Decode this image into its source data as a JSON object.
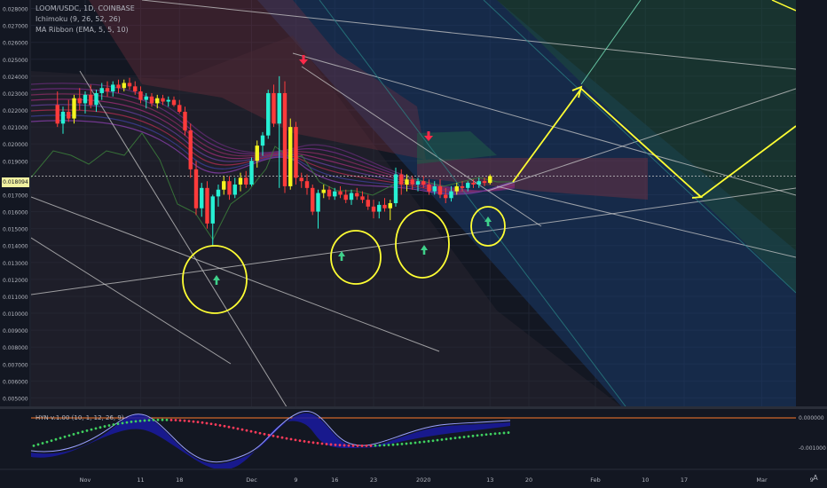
{
  "title_line": "LOOM/USDC, 1D, COINBASE",
  "indicators": [
    "Ichimoku (9, 26, 52, 26)",
    "MA Ribbon (EMA, 5, 5, 10)"
  ],
  "oscillator_label": "HYN v.1.00 (10, 1, 12, 26, 9)",
  "current_price_label": "0.018094",
  "colors": {
    "background": "#131722",
    "bull": "#26f0d4",
    "bear": "#ff3b3b",
    "bull_yellow": "#f5f51f",
    "annotation": "#ffff33",
    "trendline": "#c9c9c9",
    "cloud_bear": "#7a3040",
    "cloud_bull": "#205848",
    "channel_blue": "#1a3a6a",
    "channel_green": "#1e4a3a",
    "arrow_down": "#ff2a4a",
    "arrow_up": "#3fd08a"
  },
  "chart_data": {
    "type": "line",
    "title": "LOOM/USDC, 1D, COINBASE",
    "y_axis": {
      "min": 0.0045,
      "max": 0.0285,
      "tick_labels": [
        "0.028000",
        "0.027000",
        "0.026000",
        "0.025000",
        "0.024000",
        "0.023000",
        "0.022000",
        "0.021000",
        "0.020000",
        "0.019000",
        "0.017000",
        "0.016000",
        "0.015000",
        "0.014000",
        "0.013000",
        "0.012000",
        "0.011000",
        "0.010000",
        "0.009000",
        "0.008000",
        "0.007000",
        "0.006000",
        "0.005000"
      ],
      "tick_values": [
        0.028,
        0.027,
        0.026,
        0.025,
        0.024,
        0.023,
        0.022,
        0.021,
        0.02,
        0.019,
        0.017,
        0.016,
        0.015,
        0.014,
        0.013,
        0.012,
        0.011,
        0.01,
        0.009,
        0.008,
        0.007,
        0.006,
        0.005
      ]
    },
    "x_axis": {
      "tick_labels": [
        "Nov",
        "11",
        "18",
        "Dec",
        "9",
        "16",
        "23",
        "2020",
        "13",
        "20",
        "Feb",
        "10",
        "17",
        "Mar",
        "9"
      ],
      "tick_days": [
        0,
        10,
        17,
        30,
        38,
        45,
        52,
        61,
        73,
        80,
        92,
        101,
        108,
        122,
        131
      ]
    },
    "oscillator_axis": {
      "tick_labels": [
        "0.000000",
        "-0.001000"
      ],
      "tick_values": [
        0.0,
        -0.001
      ]
    },
    "series": [
      {
        "kind": "candles",
        "start_day": -5,
        "candles": [
          [
            0.0223,
            0.0231,
            0.021,
            0.0212
          ],
          [
            0.0212,
            0.0222,
            0.0206,
            0.0219
          ],
          [
            0.0219,
            0.0226,
            0.0213,
            0.0215
          ],
          [
            0.0215,
            0.0229,
            0.0212,
            0.0227
          ],
          [
            0.0227,
            0.0233,
            0.022,
            0.0224
          ],
          [
            0.0224,
            0.0231,
            0.0218,
            0.0229
          ],
          [
            0.0229,
            0.0235,
            0.0221,
            0.0223
          ],
          [
            0.0223,
            0.0232,
            0.0219,
            0.023
          ],
          [
            0.023,
            0.0236,
            0.0226,
            0.0233
          ],
          [
            0.0233,
            0.0237,
            0.0228,
            0.0231
          ],
          [
            0.0231,
            0.0237,
            0.0228,
            0.0235
          ],
          [
            0.0235,
            0.0238,
            0.023,
            0.0233
          ],
          [
            0.0233,
            0.0238,
            0.0231,
            0.0236
          ],
          [
            0.0236,
            0.0239,
            0.0232,
            0.0234
          ],
          [
            0.0234,
            0.0237,
            0.0229,
            0.0231
          ],
          [
            0.0231,
            0.0234,
            0.0224,
            0.0226
          ],
          [
            0.0226,
            0.023,
            0.0221,
            0.0228
          ],
          [
            0.0228,
            0.023,
            0.0222,
            0.0224
          ],
          [
            0.0224,
            0.0229,
            0.0221,
            0.0227
          ],
          [
            0.0227,
            0.0229,
            0.0223,
            0.0225
          ],
          [
            0.0225,
            0.0228,
            0.0222,
            0.0226
          ],
          [
            0.0226,
            0.0228,
            0.0222,
            0.0223
          ],
          [
            0.0223,
            0.0226,
            0.0218,
            0.0219
          ],
          [
            0.0219,
            0.0222,
            0.0205,
            0.0208
          ],
          [
            0.0208,
            0.0212,
            0.018,
            0.0185
          ],
          [
            0.0185,
            0.019,
            0.0158,
            0.0162
          ],
          [
            0.0162,
            0.0177,
            0.0157,
            0.0174
          ],
          [
            0.0174,
            0.0178,
            0.015,
            0.0153
          ],
          [
            0.0153,
            0.017,
            0.014,
            0.0169
          ],
          [
            0.0169,
            0.0176,
            0.0163,
            0.0173
          ],
          [
            0.0173,
            0.0181,
            0.017,
            0.0178
          ],
          [
            0.0178,
            0.0181,
            0.0167,
            0.017
          ],
          [
            0.017,
            0.018,
            0.0168,
            0.0176
          ],
          [
            0.0176,
            0.0183,
            0.0172,
            0.018
          ],
          [
            0.018,
            0.0184,
            0.0174,
            0.0176
          ],
          [
            0.0176,
            0.0192,
            0.0175,
            0.019
          ],
          [
            0.019,
            0.0202,
            0.0186,
            0.0199
          ],
          [
            0.0199,
            0.0207,
            0.0193,
            0.0205
          ],
          [
            0.0205,
            0.0232,
            0.0203,
            0.023
          ],
          [
            0.023,
            0.0235,
            0.021,
            0.0212
          ],
          [
            0.0212,
            0.024,
            0.0174,
            0.023
          ],
          [
            0.023,
            0.0237,
            0.0171,
            0.0175
          ],
          [
            0.0175,
            0.0215,
            0.0173,
            0.021
          ],
          [
            0.021,
            0.0213,
            0.0176,
            0.018
          ],
          [
            0.018,
            0.0183,
            0.0174,
            0.0178
          ],
          [
            0.0178,
            0.0182,
            0.017,
            0.0174
          ],
          [
            0.0174,
            0.0176,
            0.0158,
            0.016
          ],
          [
            0.016,
            0.0173,
            0.015,
            0.0171
          ],
          [
            0.0171,
            0.0176,
            0.0168,
            0.0173
          ],
          [
            0.0173,
            0.0175,
            0.0167,
            0.0169
          ],
          [
            0.0169,
            0.0174,
            0.0167,
            0.0172
          ],
          [
            0.0172,
            0.0175,
            0.0168,
            0.017
          ],
          [
            0.017,
            0.0173,
            0.0165,
            0.0167
          ],
          [
            0.0167,
            0.0173,
            0.0164,
            0.0171
          ],
          [
            0.0171,
            0.0174,
            0.0167,
            0.0169
          ],
          [
            0.0169,
            0.0172,
            0.0165,
            0.0167
          ],
          [
            0.0167,
            0.017,
            0.0161,
            0.0163
          ],
          [
            0.0163,
            0.0167,
            0.0156,
            0.016
          ],
          [
            0.016,
            0.0166,
            0.0156,
            0.0164
          ],
          [
            0.0164,
            0.0168,
            0.016,
            0.0162
          ],
          [
            0.0162,
            0.0167,
            0.0155,
            0.0165
          ],
          [
            0.0165,
            0.0186,
            0.0163,
            0.0182
          ],
          [
            0.0182,
            0.0185,
            0.017,
            0.0176
          ],
          [
            0.0176,
            0.0182,
            0.0172,
            0.0179
          ],
          [
            0.0179,
            0.0181,
            0.0173,
            0.0176
          ],
          [
            0.0176,
            0.018,
            0.0172,
            0.0178
          ],
          [
            0.0178,
            0.0181,
            0.0174,
            0.0176
          ],
          [
            0.0176,
            0.0179,
            0.017,
            0.0172
          ],
          [
            0.0172,
            0.0178,
            0.017,
            0.0175
          ],
          [
            0.0175,
            0.0179,
            0.0168,
            0.017
          ],
          [
            0.017,
            0.0174,
            0.0165,
            0.0168
          ],
          [
            0.0168,
            0.0175,
            0.0166,
            0.0172
          ],
          [
            0.0172,
            0.0177,
            0.017,
            0.0175
          ],
          [
            0.0175,
            0.0178,
            0.0172,
            0.0174
          ],
          [
            0.0174,
            0.0178,
            0.0172,
            0.0177
          ],
          [
            0.0177,
            0.0179,
            0.0174,
            0.0176
          ],
          [
            0.0176,
            0.018,
            0.0174,
            0.0178
          ],
          [
            0.0178,
            0.018,
            0.0175,
            0.0177
          ],
          [
            0.0177,
            0.0182,
            0.0176,
            0.0181
          ]
        ]
      }
    ],
    "annotations": {
      "circled_lows": 4,
      "down_arrows": 2,
      "up_arrows": 4,
      "projected_path": [
        [
          "day",
          76,
          0.018
        ],
        [
          "day",
          90,
          0.024
        ],
        [
          "day",
          105,
          0.0173
        ],
        [
          "day",
          127,
          0.021
        ]
      ]
    },
    "grid": true
  }
}
